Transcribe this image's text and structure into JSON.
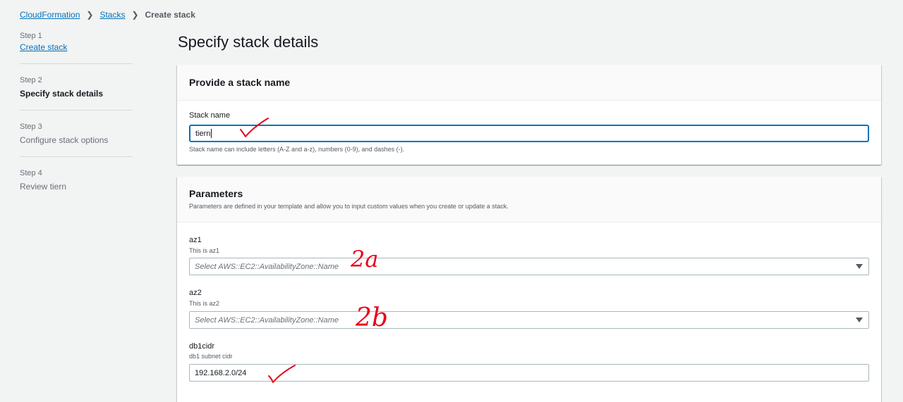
{
  "breadcrumb": {
    "items": [
      "CloudFormation",
      "Stacks"
    ],
    "current": "Create stack"
  },
  "steps": [
    {
      "num": "Step 1",
      "title": "Create stack",
      "state": "link"
    },
    {
      "num": "Step 2",
      "title": "Specify stack details",
      "state": "active"
    },
    {
      "num": "Step 3",
      "title": "Configure stack options",
      "state": "disabled"
    },
    {
      "num": "Step 4",
      "title": "Review tiern",
      "state": "disabled"
    }
  ],
  "page_title": "Specify stack details",
  "stack_name_panel": {
    "title": "Provide a stack name",
    "label": "Stack name",
    "value": "tiern",
    "constraint": "Stack name can include letters (A-Z and a-z), numbers (0-9), and dashes (-)."
  },
  "parameters_panel": {
    "title": "Parameters",
    "description": "Parameters are defined in your template and allow you to input custom values when you create or update a stack.",
    "fields": [
      {
        "label": "az1",
        "desc": "This is az1",
        "placeholder": "Select AWS::EC2::AvailabilityZone::Name"
      },
      {
        "label": "az2",
        "desc": "This is az2",
        "placeholder": "Select AWS::EC2::AvailabilityZone::Name"
      },
      {
        "label": "db1cidr",
        "desc": "db1 subnet cidr",
        "value": "192.168.2.0/24"
      }
    ]
  },
  "annotations": {
    "az1_note": "2a",
    "az2_note": "2b",
    "color": "#e8001c"
  }
}
